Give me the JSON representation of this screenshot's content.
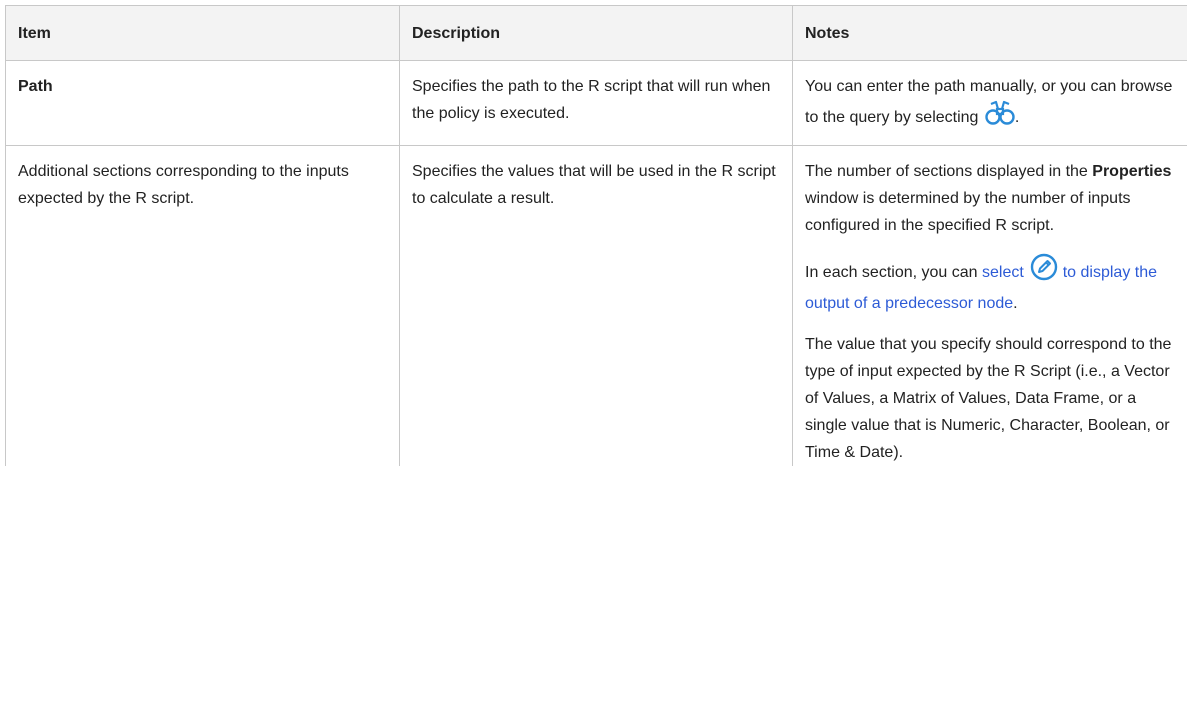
{
  "table": {
    "headers": {
      "item": "Item",
      "description": "Description",
      "notes": "Notes"
    },
    "rows": [
      {
        "item": "Path",
        "description": "Specifies the path to the R script that will run when the policy is executed.",
        "notes": {
          "text_before_icon": "You can enter the path manually, or you can browse to the query by selecting",
          "icon": "binoculars-icon",
          "text_after_icon": "."
        }
      },
      {
        "item": "Additional sections corresponding to the inputs expected by the R script.",
        "description": "Specifies the values that will be used in the R script to calculate a result.",
        "notes": {
          "para1_before": "The number of sections displayed in the",
          "para1_bold": "Properties",
          "para1_after": "window is determined by the number of inputs configured in the specified R script.",
          "para2_before": "In each section, you can",
          "para2_link_part1": "select",
          "para2_icon": "pencil-icon",
          "para2_link_part2": "to display the output of a predecessor node",
          "para2_after": ".",
          "para3": "The value that you specify should correspond to the type of input expected by the R Script (i.e., a Vector of Values, a Matrix of Values, Data Frame, or a single value that is Numeric, Character, Boolean, or Time & Date)."
        }
      }
    ]
  },
  "colors": {
    "header_bg": "#f3f3f3",
    "border": "#c8c8c8",
    "link": "#2d5bd6",
    "icon_blue": "#2a8bd8"
  }
}
